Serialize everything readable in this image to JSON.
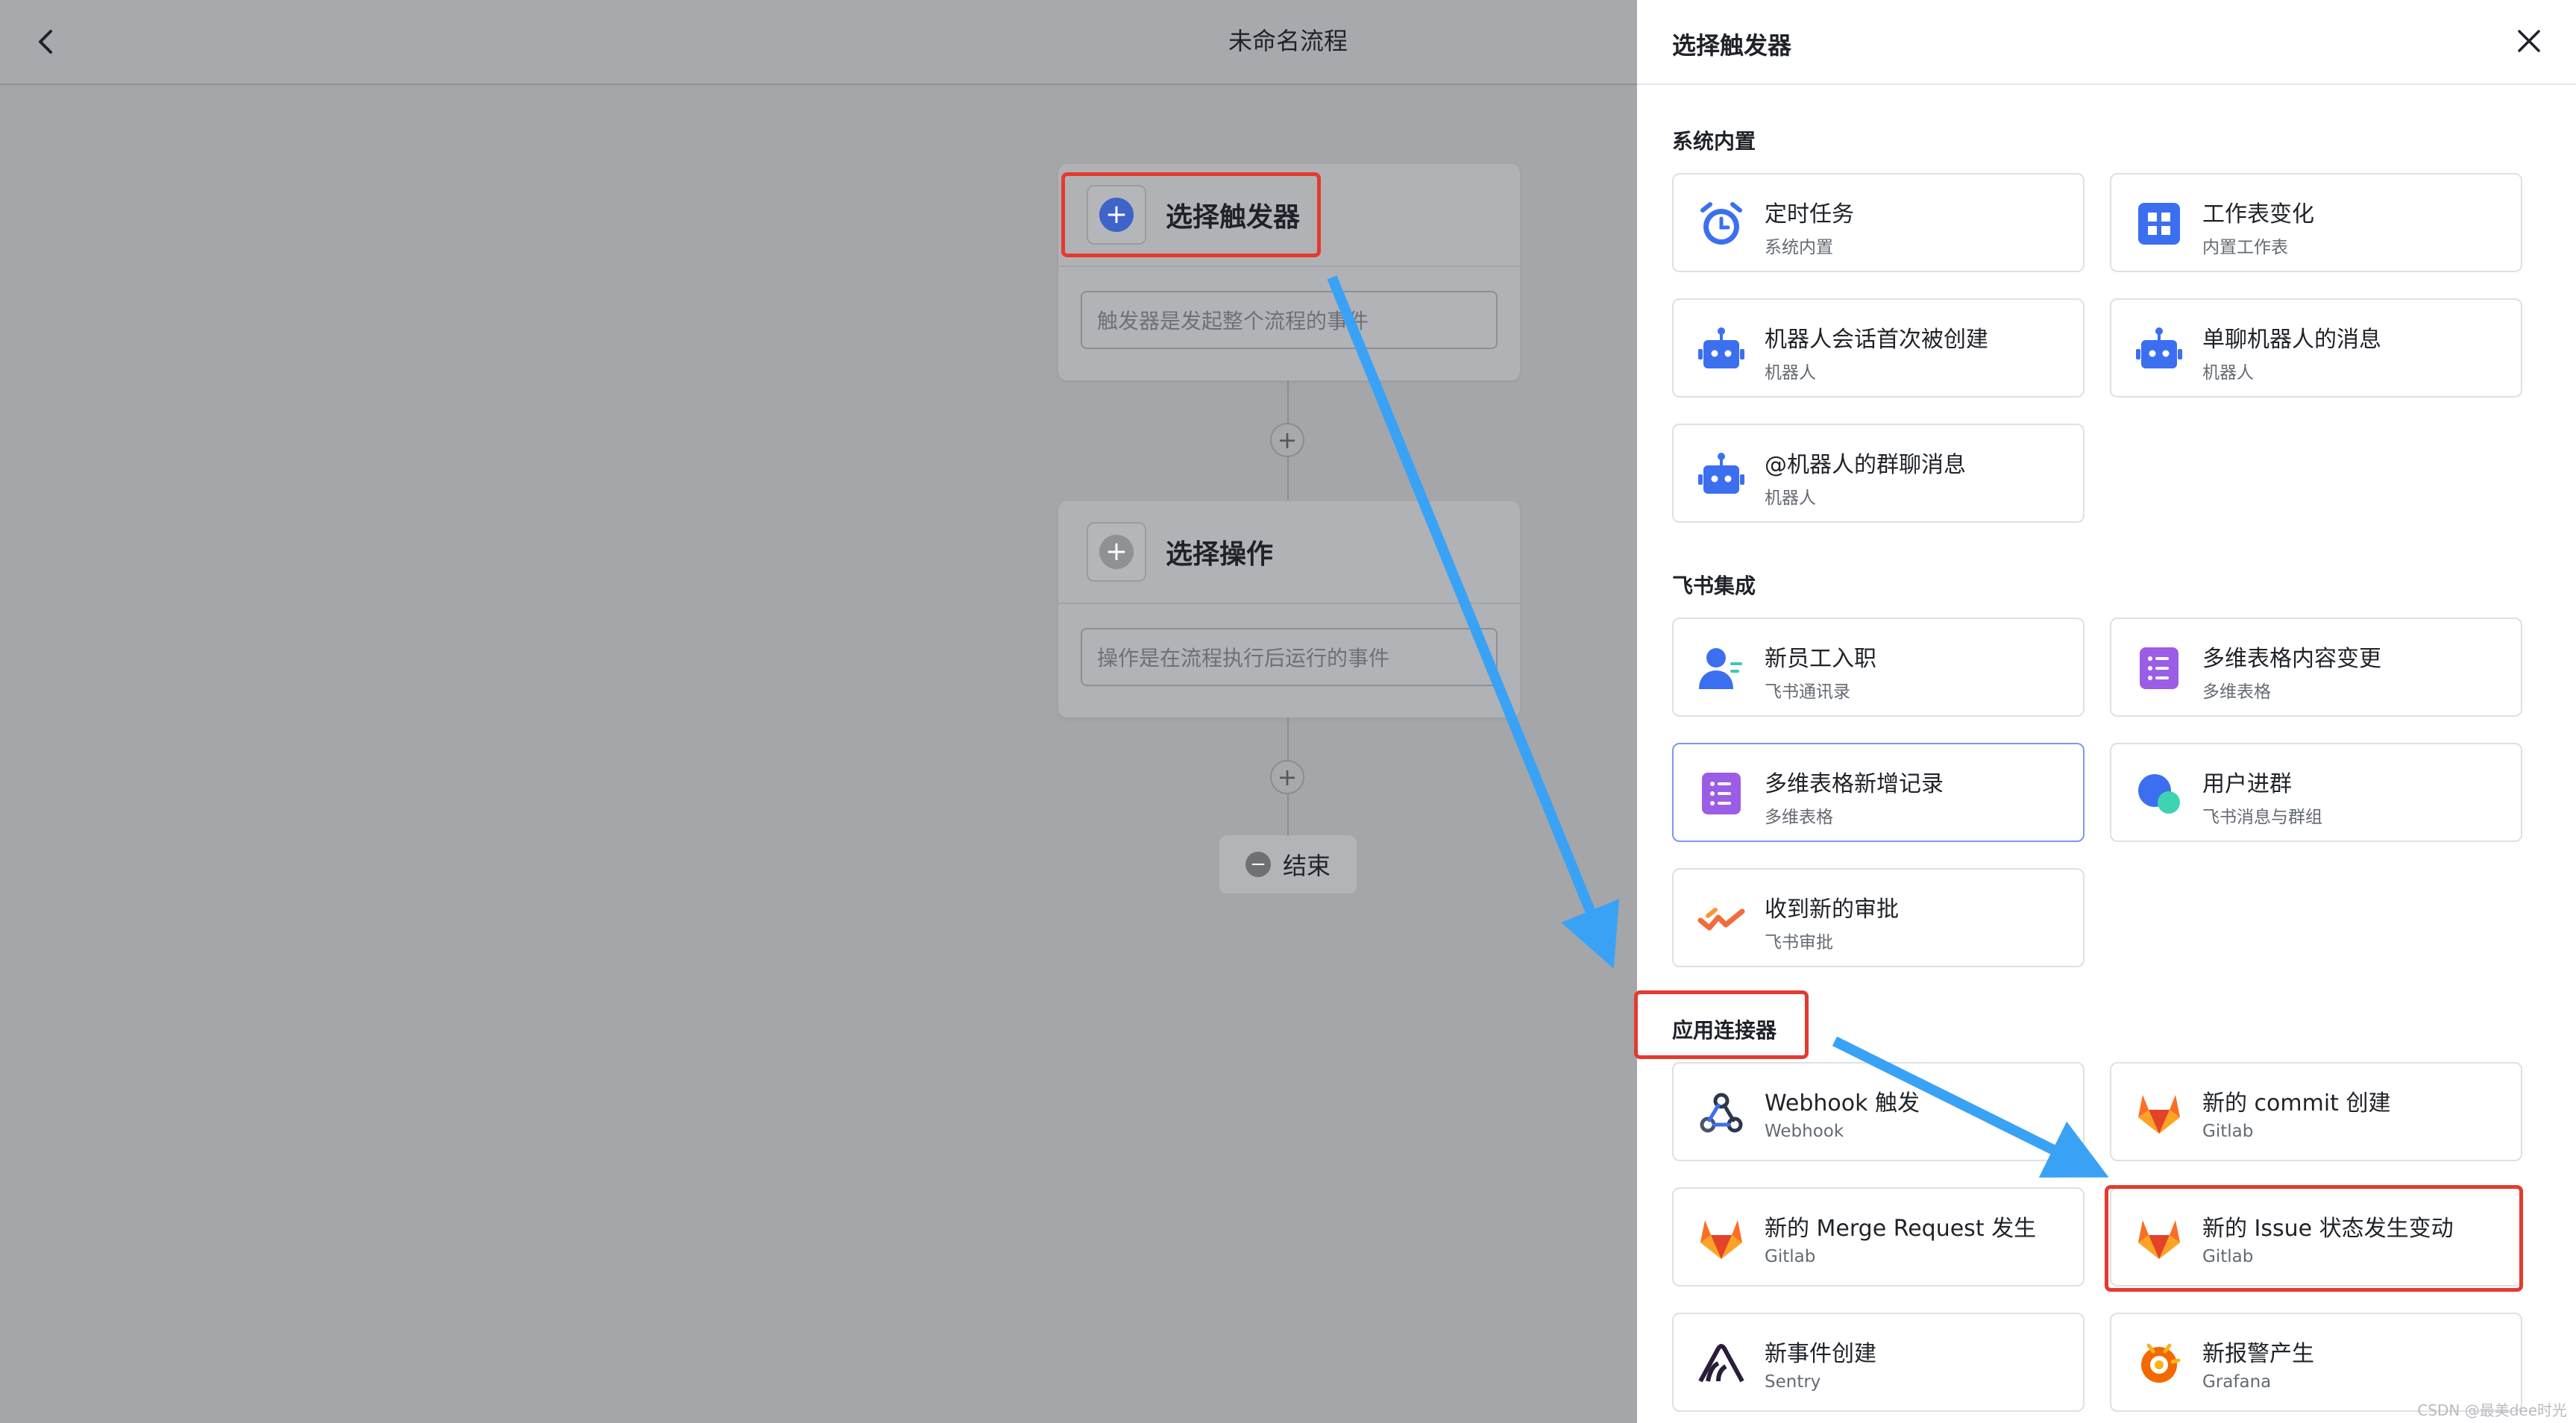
{
  "header": {
    "title": "未命名流程"
  },
  "canvas": {
    "trigger_node": {
      "title": "选择触发器",
      "placeholder": "触发器是发起整个流程的事件"
    },
    "action_node": {
      "title": "选择操作",
      "placeholder": "操作是在流程执行后运行的事件"
    },
    "end_label": "结束"
  },
  "drawer": {
    "title": "选择触发器",
    "sections": [
      {
        "title": "系统内置",
        "cards": [
          {
            "title": "定时任务",
            "subtitle": "系统内置",
            "icon": "alarm-clock-icon"
          },
          {
            "title": "工作表变化",
            "subtitle": "内置工作表",
            "icon": "grid-icon"
          },
          {
            "title": "机器人会话首次被创建",
            "subtitle": "机器人",
            "icon": "robot-icon"
          },
          {
            "title": "单聊机器人的消息",
            "subtitle": "机器人",
            "icon": "robot-icon"
          },
          {
            "title": "@机器人的群聊消息",
            "subtitle": "机器人",
            "icon": "robot-icon"
          }
        ]
      },
      {
        "title": "飞书集成",
        "cards": [
          {
            "title": "新员工入职",
            "subtitle": "飞书通讯录",
            "icon": "user-icon"
          },
          {
            "title": "多维表格内容变更",
            "subtitle": "多维表格",
            "icon": "bitable-icon"
          },
          {
            "title": "多维表格新增记录",
            "subtitle": "多维表格",
            "icon": "bitable-icon"
          },
          {
            "title": "用户进群",
            "subtitle": "飞书消息与群组",
            "icon": "chat-bubble-icon"
          },
          {
            "title": "收到新的审批",
            "subtitle": "飞书审批",
            "icon": "approval-icon"
          }
        ]
      },
      {
        "title": "应用连接器",
        "cards": [
          {
            "title": "Webhook 触发",
            "subtitle": "Webhook",
            "icon": "webhook-icon"
          },
          {
            "title": "新的 commit 创建",
            "subtitle": "Gitlab",
            "icon": "gitlab-icon"
          },
          {
            "title": "新的 Merge Request 发生",
            "subtitle": "Gitlab",
            "icon": "gitlab-icon"
          },
          {
            "title": "新的 Issue 状态发生变动",
            "subtitle": "Gitlab",
            "icon": "gitlab-icon"
          },
          {
            "title": "新事件创建",
            "subtitle": "Sentry",
            "icon": "sentry-icon"
          },
          {
            "title": "新报警产生",
            "subtitle": "Grafana",
            "icon": "grafana-icon"
          }
        ]
      }
    ]
  },
  "watermark": "CSDN @最美dee时光",
  "colors": {
    "accent": "#3370ff",
    "highlight_box": "#e53a2e",
    "annotation_arrow": "#3aa2f5"
  }
}
